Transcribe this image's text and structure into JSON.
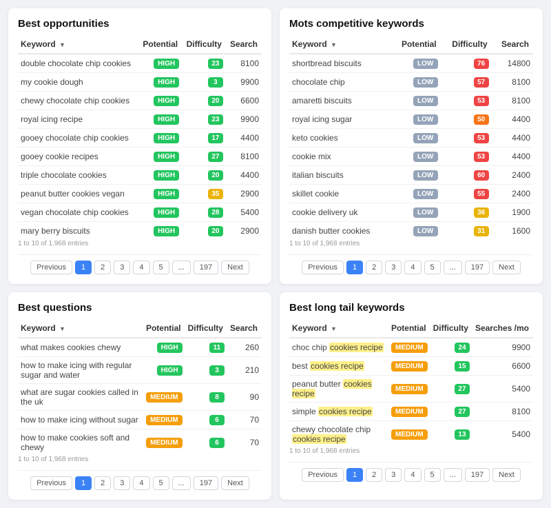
{
  "panels": [
    {
      "id": "best-opportunities",
      "title": "Best opportunities",
      "columns": [
        "Keyword",
        "Potential",
        "Difficulty",
        "Search"
      ],
      "rows": [
        {
          "keyword": "double chocolate chip cookies",
          "potential": "HIGH",
          "potential_class": "high",
          "difficulty": "23",
          "diff_class": "green",
          "searches": "8100"
        },
        {
          "keyword": "my cookie dough",
          "potential": "HIGH",
          "potential_class": "high",
          "difficulty": "3",
          "diff_class": "green",
          "searches": "9900"
        },
        {
          "keyword": "chewy chocolate chip cookies",
          "potential": "HIGH",
          "potential_class": "high",
          "difficulty": "20",
          "diff_class": "green",
          "searches": "6600"
        },
        {
          "keyword": "royal icing recipe",
          "potential": "HIGH",
          "potential_class": "high",
          "difficulty": "23",
          "diff_class": "green",
          "searches": "9900"
        },
        {
          "keyword": "gooey chocolate chip cookies",
          "potential": "HIGH",
          "potential_class": "high",
          "difficulty": "17",
          "diff_class": "green",
          "searches": "4400"
        },
        {
          "keyword": "gooey cookie recipes",
          "potential": "HIGH",
          "potential_class": "high",
          "difficulty": "27",
          "diff_class": "green",
          "searches": "8100"
        },
        {
          "keyword": "triple chocolate cookies",
          "potential": "HIGH",
          "potential_class": "high",
          "difficulty": "20",
          "diff_class": "green",
          "searches": "4400"
        },
        {
          "keyword": "peanut butter cookies vegan",
          "potential": "HIGH",
          "potential_class": "high",
          "difficulty": "35",
          "diff_class": "yellow",
          "searches": "2900"
        },
        {
          "keyword": "vegan chocolate chip cookies",
          "potential": "HIGH",
          "potential_class": "high",
          "difficulty": "28",
          "diff_class": "green",
          "searches": "5400"
        },
        {
          "keyword": "mary berry biscuits",
          "potential": "HIGH",
          "potential_class": "high",
          "difficulty": "20",
          "diff_class": "green",
          "searches": "2900"
        }
      ],
      "pagination": {
        "info": "1 to 10 of 1,968 entries",
        "prev": "Previous",
        "next": "Next",
        "pages": [
          "1",
          "2",
          "3",
          "4",
          "5",
          "...",
          "197"
        ]
      }
    },
    {
      "id": "mots-competitive",
      "title": "Mots competitive keywords",
      "columns": [
        "Keyword",
        "Potential",
        "Difficulty",
        "Search"
      ],
      "rows": [
        {
          "keyword": "shortbread biscuits",
          "potential": "LOW",
          "potential_class": "low",
          "difficulty": "76",
          "diff_class": "red",
          "searches": "14800"
        },
        {
          "keyword": "chocolate chip",
          "potential": "LOW",
          "potential_class": "low",
          "difficulty": "57",
          "diff_class": "red",
          "searches": "8100"
        },
        {
          "keyword": "amaretti biscuits",
          "potential": "LOW",
          "potential_class": "low",
          "difficulty": "53",
          "diff_class": "red",
          "searches": "8100"
        },
        {
          "keyword": "royal icing sugar",
          "potential": "LOW",
          "potential_class": "low",
          "difficulty": "50",
          "diff_class": "orange",
          "searches": "4400"
        },
        {
          "keyword": "keto cookies",
          "potential": "LOW",
          "potential_class": "low",
          "difficulty": "53",
          "diff_class": "red",
          "searches": "4400"
        },
        {
          "keyword": "cookie mix",
          "potential": "LOW",
          "potential_class": "low",
          "difficulty": "53",
          "diff_class": "red",
          "searches": "4400"
        },
        {
          "keyword": "italian biscuits",
          "potential": "LOW",
          "potential_class": "low",
          "difficulty": "60",
          "diff_class": "red",
          "searches": "2400"
        },
        {
          "keyword": "skillet cookie",
          "potential": "LOW",
          "potential_class": "low",
          "difficulty": "55",
          "diff_class": "red",
          "searches": "2400"
        },
        {
          "keyword": "cookie delivery uk",
          "potential": "LOW",
          "potential_class": "low",
          "difficulty": "36",
          "diff_class": "yellow",
          "searches": "1900"
        },
        {
          "keyword": "danish butter cookies",
          "potential": "LOW",
          "potential_class": "low",
          "difficulty": "31",
          "diff_class": "yellow",
          "searches": "1600"
        }
      ],
      "pagination": {
        "info": "1 to 10 of 1,968 entries",
        "prev": "Previous",
        "next": "Next",
        "pages": [
          "1",
          "2",
          "3",
          "4",
          "5",
          "...",
          "197"
        ]
      }
    },
    {
      "id": "best-questions",
      "title": "Best questions",
      "columns": [
        "Keyword",
        "Potential",
        "Difficulty",
        "Search"
      ],
      "rows": [
        {
          "keyword": "what makes cookies chewy",
          "potential": "HIGH",
          "potential_class": "high",
          "difficulty": "11",
          "diff_class": "green",
          "searches": "260"
        },
        {
          "keyword": "how to make icing with regular sugar and water",
          "potential": "HIGH",
          "potential_class": "high",
          "difficulty": "3",
          "diff_class": "green",
          "searches": "210"
        },
        {
          "keyword": "what are sugar cookies called in the uk",
          "potential": "MEDIUM",
          "potential_class": "medium",
          "difficulty": "8",
          "diff_class": "green",
          "searches": "90"
        },
        {
          "keyword": "how to make icing without sugar",
          "potential": "MEDIUM",
          "potential_class": "medium",
          "difficulty": "6",
          "diff_class": "green",
          "searches": "70"
        },
        {
          "keyword": "how to make cookies soft and chewy",
          "potential": "MEDIUM",
          "potential_class": "medium",
          "difficulty": "6",
          "diff_class": "green",
          "searches": "70"
        }
      ],
      "pagination": {
        "info": "1 to 10 of 1,968 entries",
        "prev": "Previous",
        "next": "Next",
        "pages": [
          "1",
          "2",
          "3",
          "4",
          "5",
          "...",
          "197"
        ]
      }
    },
    {
      "id": "best-long-tail",
      "title": "Best long tail keywords",
      "columns": [
        "Keyword",
        "Potential",
        "Difficulty",
        "Searches /mo"
      ],
      "rows": [
        {
          "keyword": "choc chip ",
          "keyword_highlight": "cookies recipe",
          "potential": "MEDIUM",
          "potential_class": "medium",
          "difficulty": "24",
          "diff_class": "green",
          "searches": "9900"
        },
        {
          "keyword": "best ",
          "keyword_highlight": "cookies recipe",
          "potential": "MEDIUM",
          "potential_class": "medium",
          "difficulty": "15",
          "diff_class": "green",
          "searches": "6600"
        },
        {
          "keyword": "peanut butter ",
          "keyword_highlight": "cookies recipe",
          "potential": "MEDIUM",
          "potential_class": "medium",
          "difficulty": "27",
          "diff_class": "green",
          "searches": "5400"
        },
        {
          "keyword": "simple ",
          "keyword_highlight": "cookies recipe",
          "potential": "MEDIUM",
          "potential_class": "medium",
          "difficulty": "27",
          "diff_class": "green",
          "searches": "8100"
        },
        {
          "keyword": "chewy chocolate chip ",
          "keyword_highlight": "cookies recipe",
          "potential": "MEDIUM",
          "potential_class": "medium",
          "difficulty": "13",
          "diff_class": "green",
          "searches": "5400"
        }
      ],
      "pagination": {
        "info": "1 to 10 of 1,968 entries",
        "prev": "Previous",
        "next": "Next",
        "pages": [
          "1",
          "2",
          "3",
          "4",
          "5",
          "...",
          "197"
        ]
      }
    }
  ]
}
